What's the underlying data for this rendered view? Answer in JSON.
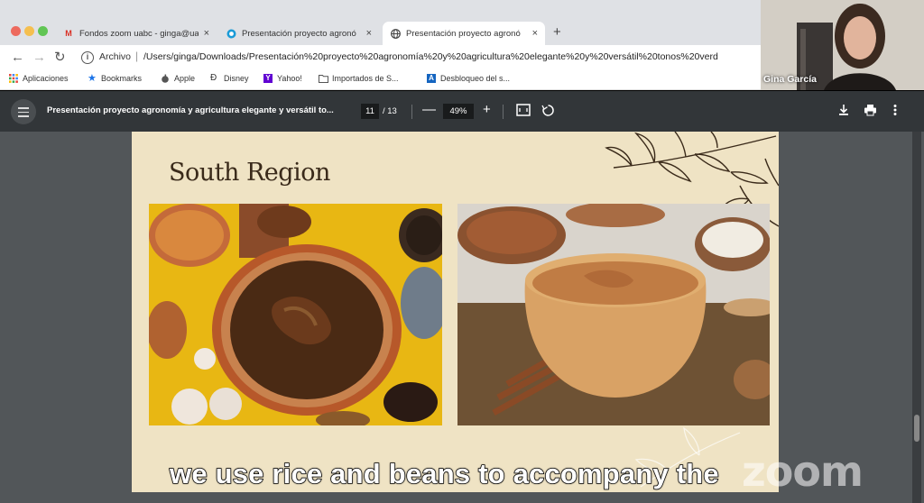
{
  "browser": {
    "tabs": [
      {
        "label": "Fondos zoom uabc - ginga@ua",
        "icon": "gmail-icon",
        "active": false
      },
      {
        "label": "Presentación proyecto agronó",
        "icon": "canva-icon",
        "active": false
      },
      {
        "label": "Presentación proyecto agronó",
        "icon": "globe-icon",
        "active": true
      }
    ],
    "new_tab": "+",
    "close_glyph": "×",
    "address": {
      "scheme": "Archivo",
      "url": "/Users/ginga/Downloads/Presentación%20proyecto%20agronomía%20y%20agricultura%20elegante%20y%20versátil%20tonos%20verd"
    },
    "bookmarks": [
      {
        "label": "Aplicaciones",
        "icon": "apps-grid-icon"
      },
      {
        "label": "Bookmarks",
        "icon": "star-icon"
      },
      {
        "label": "Apple",
        "icon": "apple-icon"
      },
      {
        "label": "Disney",
        "icon": "disney-icon"
      },
      {
        "label": "Yahoo!",
        "icon": "yahoo-icon"
      },
      {
        "label": "Importados de S...",
        "icon": "folder-icon"
      },
      {
        "label": "Desbloqueo del s...",
        "icon": "a-logo-icon"
      }
    ]
  },
  "pdf_viewer": {
    "title": "Presentación proyecto agronomía y agricultura elegante y versátil to...",
    "current_page": "11",
    "total_pages": "/ 13",
    "zoom": "49%",
    "zoom_out": "—",
    "zoom_in": "+"
  },
  "slide": {
    "title": "South Region",
    "images": [
      {
        "name": "mole-platter-photo",
        "subject": "mole dish with spices"
      },
      {
        "name": "drink-bowl-photo",
        "subject": "bowl of hot drink"
      }
    ]
  },
  "zoom_overlay": {
    "participant_name": "Gina García",
    "logo": "zoom",
    "caption": "we use rice and beans to accompany the"
  }
}
